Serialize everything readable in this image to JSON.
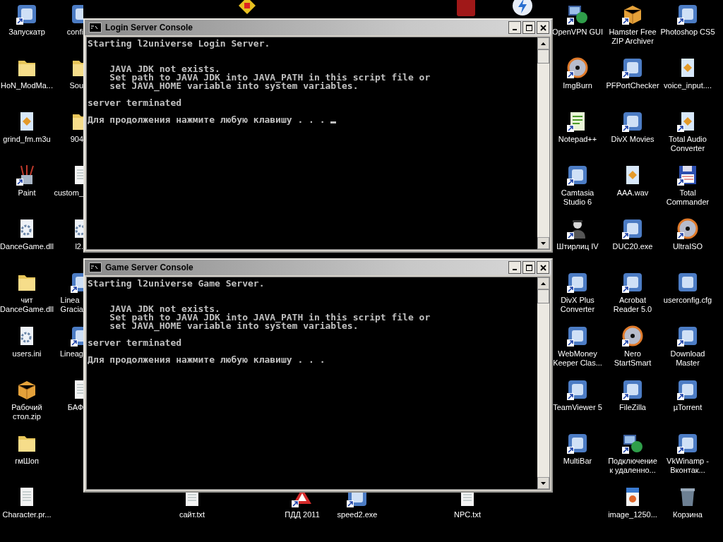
{
  "desktop": {
    "icons": [
      {
        "label": "Запускатр",
        "kind": "app",
        "shortcut": true
      },
      {
        "label": "HoN_ModMa...",
        "kind": "folder",
        "shortcut": false
      },
      {
        "label": "grind_fm.m3u",
        "kind": "media",
        "shortcut": false
      },
      {
        "label": "Paint",
        "kind": "paint",
        "shortcut": true
      },
      {
        "label": "DanceGame.dll",
        "kind": "config",
        "shortcut": false
      },
      {
        "label": "чит\nDanceGame.dll",
        "kind": "folder",
        "shortcut": false
      },
      {
        "label": "users.ini",
        "kind": "config",
        "shortcut": false
      },
      {
        "label": "Рабочий\nстол.zip",
        "kind": "archive",
        "shortcut": false
      },
      {
        "label": "гмШоп",
        "kind": "folder",
        "shortcut": false
      },
      {
        "label": "Character.pr...",
        "kind": "text",
        "shortcut": false
      },
      {
        "label": "confi",
        "kind": "app",
        "shortcut": false
      },
      {
        "label": "Sou",
        "kind": "folder",
        "shortcut": false
      },
      {
        "label": "904",
        "kind": "folder",
        "shortcut": false
      },
      {
        "label": "custom_",
        "kind": "text",
        "shortcut": false
      },
      {
        "label": "l2.",
        "kind": "config",
        "shortcut": false
      },
      {
        "label": "Linea\nGracia",
        "kind": "app",
        "shortcut": true
      },
      {
        "label": "Lineag",
        "kind": "app",
        "shortcut": true
      },
      {
        "label": "БАФ",
        "kind": "text",
        "shortcut": false
      },
      {
        "label": "сайт.txt",
        "kind": "text",
        "shortcut": false
      },
      {
        "label": "ПДД 2011",
        "kind": "sign",
        "shortcut": true
      },
      {
        "label": "speed2.exe",
        "kind": "app",
        "shortcut": true
      },
      {
        "label": "NPC.txt",
        "kind": "text",
        "shortcut": false
      },
      {
        "label": "OpenVPN GUI",
        "kind": "network",
        "shortcut": true
      },
      {
        "label": "ImgBurn",
        "kind": "disc",
        "shortcut": true
      },
      {
        "label": "Notepad++",
        "kind": "notepad",
        "shortcut": true
      },
      {
        "label": "Camtasia\nStudio 6",
        "kind": "app",
        "shortcut": true
      },
      {
        "label": "Штирлиц IV",
        "kind": "figure",
        "shortcut": true
      },
      {
        "label": "DivX Plus\nConverter",
        "kind": "app",
        "shortcut": true
      },
      {
        "label": "WebMoney\nKeeper Clas...",
        "kind": "app",
        "shortcut": true
      },
      {
        "label": "TeamViewer 5",
        "kind": "app",
        "shortcut": true
      },
      {
        "label": "MultiBar",
        "kind": "app",
        "shortcut": true
      },
      {
        "label": "Hamster Free\nZIP Archiver",
        "kind": "archive",
        "shortcut": true
      },
      {
        "label": "PFPortChecker",
        "kind": "app",
        "shortcut": true
      },
      {
        "label": "DivX Movies",
        "kind": "app",
        "shortcut": true
      },
      {
        "label": "AAA.wav",
        "kind": "media",
        "shortcut": false
      },
      {
        "label": "DUC20.exe",
        "kind": "app",
        "shortcut": true
      },
      {
        "label": "Acrobat\nReader 5.0",
        "kind": "app",
        "shortcut": true
      },
      {
        "label": "Nero\nStartSmart",
        "kind": "disc",
        "shortcut": true
      },
      {
        "label": "FileZilla",
        "kind": "app",
        "shortcut": true
      },
      {
        "label": "Подключение\nк удаленно...",
        "kind": "network",
        "shortcut": true
      },
      {
        "label": "image_1250...",
        "kind": "image",
        "shortcut": false
      },
      {
        "label": "Photoshop CS5",
        "kind": "app",
        "shortcut": true
      },
      {
        "label": "voice_input....",
        "kind": "media",
        "shortcut": false
      },
      {
        "label": "Total Audio\nConverter",
        "kind": "media",
        "shortcut": true
      },
      {
        "label": "Total\nCommander",
        "kind": "floppy",
        "shortcut": true
      },
      {
        "label": "UltraISO",
        "kind": "disc",
        "shortcut": true
      },
      {
        "label": "userconfig.cfg",
        "kind": "app",
        "shortcut": false
      },
      {
        "label": "Download\nMaster",
        "kind": "app",
        "shortcut": true
      },
      {
        "label": "µTorrent",
        "kind": "app",
        "shortcut": true
      },
      {
        "label": "VkWinamp -\nВконтак...",
        "kind": "app",
        "shortcut": true
      },
      {
        "label": "Корзина",
        "kind": "trash",
        "shortcut": false
      }
    ]
  },
  "windows": [
    {
      "title": "Login Server Console",
      "output": "Starting l2universe Login Server.\n\n\n    JAVA JDK not exists.\n    Set path to JAVA JDK into JAVA_PATH in this script file or\n    set JAVA_HOME variable into system variables.\n\nserver terminated\n\nДля продолжения нажмите любую клавишу . . . ",
      "cursor": true
    },
    {
      "title": "Game Server Console",
      "output": "Starting l2universe Game Server.\n\n\n    JAVA JDK not exists.\n    Set path to JAVA JDK into JAVA_PATH in this script file or\n    set JAVA_HOME variable into system variables.\n\nserver terminated\n\nДля продолжения нажмите любую клавишу . . .",
      "cursor": false
    }
  ]
}
